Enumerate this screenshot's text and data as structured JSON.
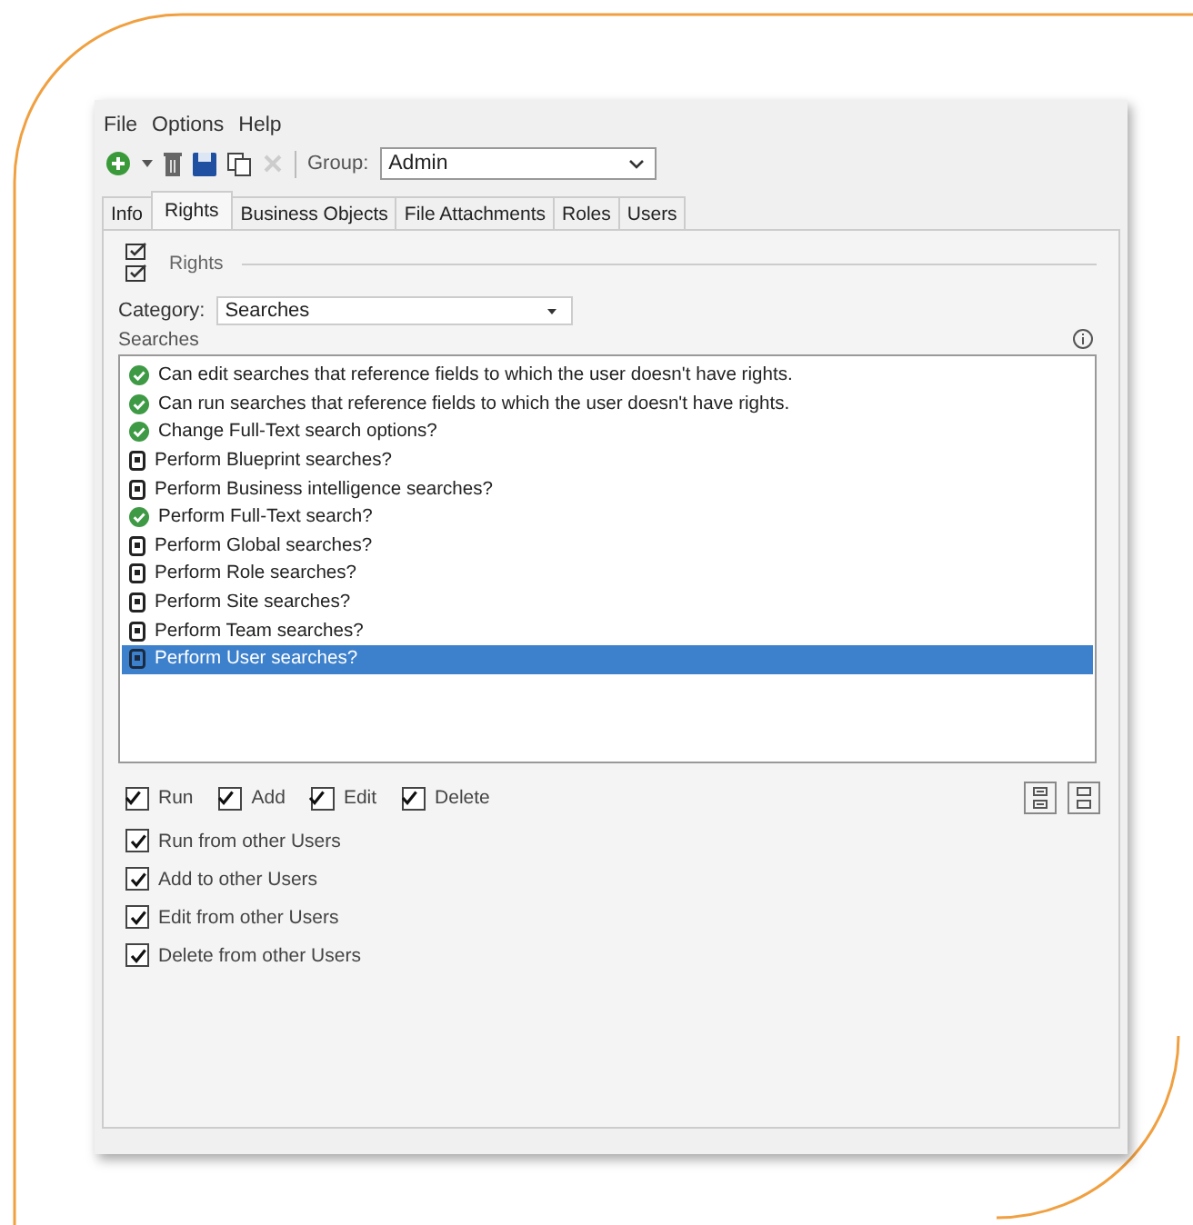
{
  "menu": [
    "File",
    "Options",
    "Help"
  ],
  "toolbar": {
    "group_label": "Group:",
    "group_value": "Admin"
  },
  "tabs": [
    {
      "label": "Info",
      "selected": false
    },
    {
      "label": "Rights",
      "selected": true
    },
    {
      "label": "Business Objects",
      "selected": false
    },
    {
      "label": "File Attachments",
      "selected": false
    },
    {
      "label": "Roles",
      "selected": false
    },
    {
      "label": "Users",
      "selected": false
    }
  ],
  "section_title": "Rights",
  "category": {
    "label": "Category:",
    "value": "Searches"
  },
  "list_title": "Searches",
  "rights": [
    {
      "label": "Can edit searches that reference fields to which the user doesn't have rights.",
      "kind": "granted",
      "selected": false
    },
    {
      "label": "Can run searches that reference fields to which the user doesn't have rights.",
      "kind": "granted",
      "selected": false
    },
    {
      "label": "Change Full-Text search options?",
      "kind": "granted",
      "selected": false
    },
    {
      "label": "Perform Blueprint searches?",
      "kind": "locked",
      "selected": false
    },
    {
      "label": "Perform Business intelligence searches?",
      "kind": "locked",
      "selected": false
    },
    {
      "label": "Perform Full-Text search?",
      "kind": "granted",
      "selected": false
    },
    {
      "label": "Perform Global searches?",
      "kind": "locked",
      "selected": false
    },
    {
      "label": "Perform Role searches?",
      "kind": "locked",
      "selected": false
    },
    {
      "label": "Perform Site searches?",
      "kind": "locked",
      "selected": false
    },
    {
      "label": "Perform Team searches?",
      "kind": "locked",
      "selected": false
    },
    {
      "label": "Perform User searches?",
      "kind": "locked",
      "selected": true
    }
  ],
  "options_row": [
    {
      "label": "Run",
      "checked": true
    },
    {
      "label": "Add",
      "checked": true
    },
    {
      "label": "Edit",
      "checked": true
    },
    {
      "label": "Delete",
      "checked": true
    }
  ],
  "options_column": [
    {
      "label": "Run from other Users",
      "checked": true
    },
    {
      "label": "Add to other Users",
      "checked": true
    },
    {
      "label": "Edit from other Users",
      "checked": true
    },
    {
      "label": "Delete from other Users",
      "checked": true
    }
  ]
}
